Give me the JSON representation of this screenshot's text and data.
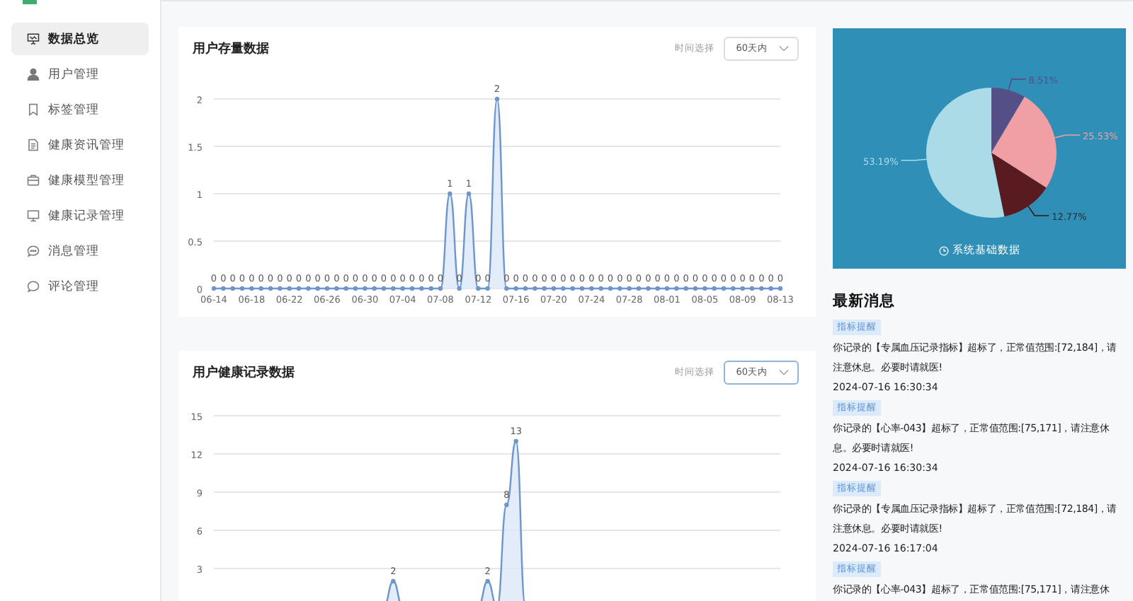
{
  "sidebar": {
    "items": [
      {
        "label": "数据总览",
        "selected": true
      },
      {
        "label": "用户管理",
        "selected": false
      },
      {
        "label": "标签管理",
        "selected": false
      },
      {
        "label": "健康资讯管理",
        "selected": false
      },
      {
        "label": "健康模型管理",
        "selected": false
      },
      {
        "label": "健康记录管理",
        "selected": false
      },
      {
        "label": "消息管理",
        "selected": false
      },
      {
        "label": "评论管理",
        "selected": false
      }
    ]
  },
  "charts": [
    {
      "title": "用户存量数据",
      "filter_label": "时间选择",
      "filter_value": "60天内",
      "chart_data": {
        "type": "area",
        "grid": true,
        "ylim": [
          0,
          2
        ],
        "yticks": [
          0,
          0.5,
          1,
          1.5,
          2
        ],
        "categories": [
          "06-14",
          null,
          null,
          null,
          "06-18",
          null,
          null,
          null,
          "06-22",
          null,
          null,
          null,
          "06-26",
          null,
          null,
          null,
          "06-30",
          null,
          null,
          null,
          "07-04",
          null,
          null,
          null,
          "07-08",
          null,
          null,
          null,
          "07-12",
          null,
          null,
          null,
          "07-16",
          null,
          null,
          null,
          "07-20",
          null,
          null,
          null,
          "07-24",
          null,
          null,
          null,
          "07-28",
          null,
          null,
          null,
          "08-01",
          null,
          null,
          null,
          "08-05",
          null,
          null,
          null,
          "08-09",
          null,
          null,
          null,
          "08-13"
        ],
        "data_labels": true,
        "values": [
          0,
          0,
          0,
          0,
          0,
          0,
          0,
          0,
          0,
          0,
          0,
          0,
          0,
          0,
          0,
          0,
          0,
          0,
          0,
          0,
          0,
          0,
          0,
          0,
          0,
          1,
          0,
          1,
          0,
          0,
          2,
          0,
          0,
          0,
          0,
          0,
          0,
          0,
          0,
          0,
          0,
          0,
          0,
          0,
          0,
          0,
          0,
          0,
          0,
          0,
          0,
          0,
          0,
          0,
          0,
          0,
          0,
          0,
          0,
          0,
          0
        ]
      }
    },
    {
      "title": "用户健康记录数据",
      "filter_label": "时间选择",
      "filter_value": "60天内",
      "chart_data": {
        "type": "area",
        "grid": true,
        "ylim": [
          0,
          15
        ],
        "yticks": [
          3,
          6,
          9,
          12,
          15
        ],
        "values": [
          0,
          0,
          0,
          0,
          0,
          0,
          0,
          0,
          0,
          0,
          0,
          0,
          0,
          0,
          0,
          0,
          0,
          0,
          0,
          2,
          0,
          0,
          0,
          0,
          0,
          0,
          0,
          0,
          0,
          2,
          0,
          8,
          13,
          0,
          0,
          0,
          0,
          0,
          0,
          0,
          0,
          0,
          0,
          0,
          0,
          0,
          0,
          0,
          0,
          0,
          0,
          0,
          0,
          0,
          0,
          0,
          0,
          0,
          0,
          0,
          0
        ],
        "value_labels": [
          null,
          null,
          null,
          null,
          null,
          null,
          null,
          null,
          null,
          null,
          null,
          null,
          null,
          null,
          null,
          null,
          null,
          null,
          null,
          "2",
          null,
          null,
          null,
          null,
          null,
          null,
          null,
          null,
          null,
          "2",
          null,
          "8",
          "13",
          null,
          null,
          null,
          null,
          null,
          null,
          null,
          null,
          null,
          null,
          null,
          null,
          null,
          null,
          null,
          null,
          null,
          null,
          null,
          null,
          null,
          null,
          null,
          null,
          null,
          null,
          null,
          null
        ]
      }
    }
  ],
  "system_panel": {
    "caption": "系统基础数据",
    "chart_data": {
      "type": "pie",
      "values": [
        8.51,
        25.53,
        12.77,
        53.19
      ],
      "value_labels": [
        "8.51%",
        "25.53%",
        "12.77%",
        "53.19%"
      ]
    }
  },
  "messages": {
    "title": "最新消息",
    "items": [
      {
        "tag": "指标提醒",
        "text": "你记录的【专属血压记录指标】超标了，正常值范围:[72,184]，请注意休息。必要时请就医!",
        "time": "2024-07-16 16:30:34"
      },
      {
        "tag": "指标提醒",
        "text": "你记录的【心率-043】超标了，正常值范围:[75,171]，请注意休息。必要时请就医!",
        "time": "2024-07-16 16:30:34"
      },
      {
        "tag": "指标提醒",
        "text": "你记录的【专属血压记录指标】超标了，正常值范围:[72,184]，请注意休息。必要时请就医!",
        "time": "2024-07-16 16:17:04"
      },
      {
        "tag": "指标提醒",
        "text": "你记录的【心率-043】超标了，正常值范围:[75,171]，请注意休"
      }
    ]
  }
}
